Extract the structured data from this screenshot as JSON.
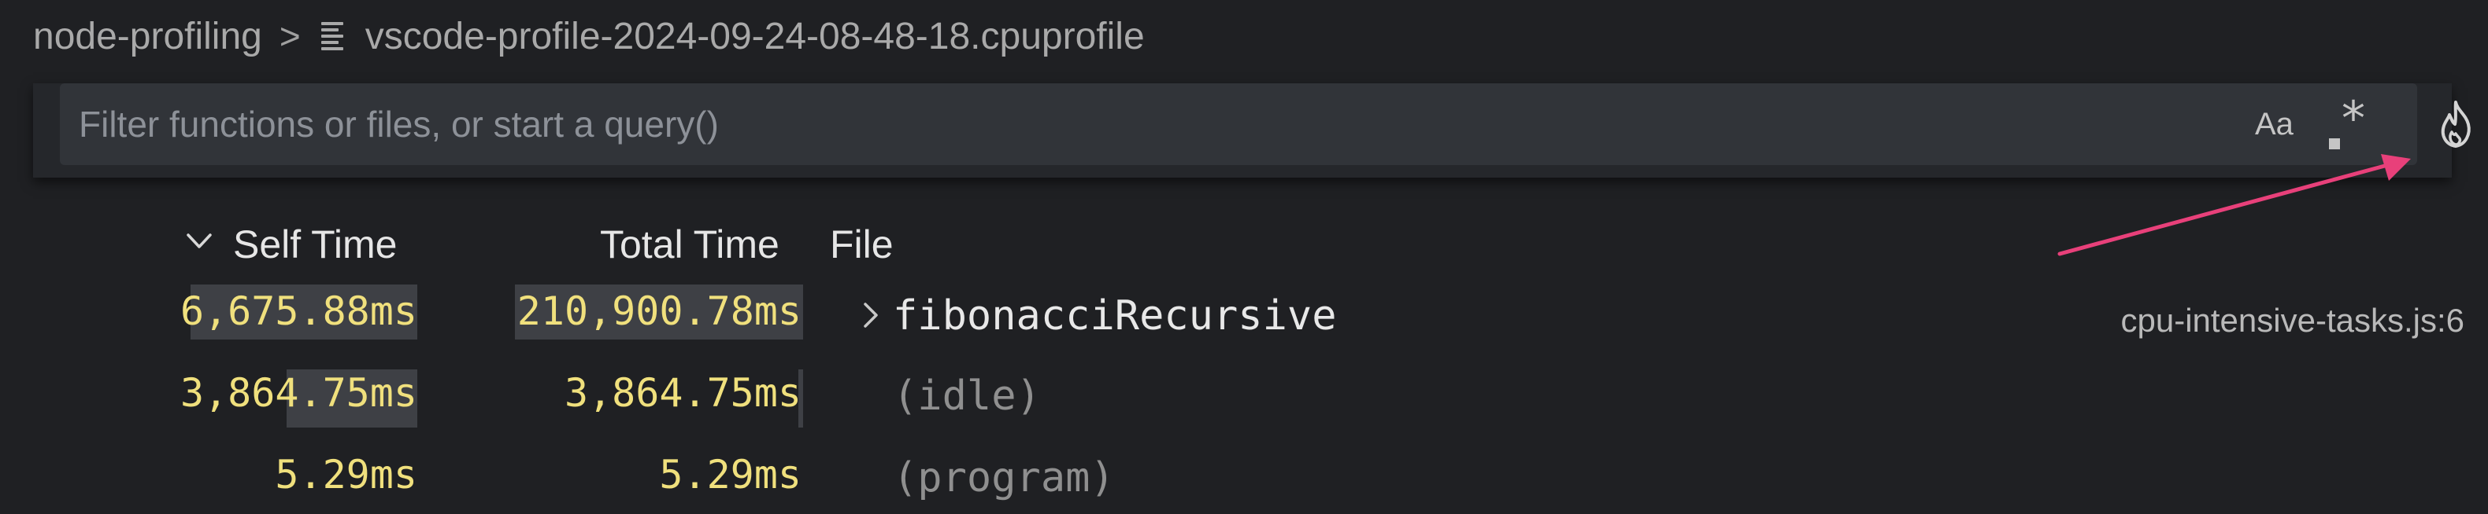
{
  "breadcrumb": {
    "folder": "node-profiling",
    "separator": ">",
    "file": "vscode-profile-2024-09-24-08-48-18.cpuprofile"
  },
  "filter": {
    "placeholder": "Filter functions or files, or start a query()",
    "value": "",
    "match_case_label": "Aa",
    "regex_label": "*",
    "flame_icon": "flame-icon"
  },
  "columns": {
    "self_time": "Self Time",
    "total_time": "Total Time",
    "file": "File"
  },
  "rows": [
    {
      "self_time": "6,675.88ms",
      "total_time": "210,900.78ms",
      "function": "fibonacciRecursive",
      "file": "cpu-intensive-tasks.js:6",
      "expandable": true
    },
    {
      "self_time": "3,864.75ms",
      "total_time": "3,864.75ms",
      "function": "(idle)",
      "file": "",
      "expandable": false
    },
    {
      "self_time": "5.29ms",
      "total_time": "5.29ms",
      "function": "(program)",
      "file": "",
      "expandable": false
    }
  ],
  "colors": {
    "background": "#1f2023",
    "time_value": "#f0e07d",
    "annotation_arrow": "#e8407a",
    "input_background": "#313439"
  }
}
